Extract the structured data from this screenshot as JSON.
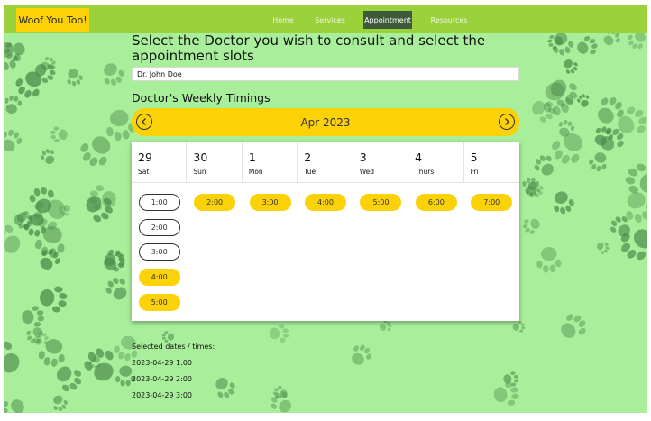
{
  "brand": "Woof You Too!",
  "nav": [
    {
      "label": "Home",
      "active": false
    },
    {
      "label": "Services",
      "active": false
    },
    {
      "label": "Appointment",
      "active": true
    },
    {
      "label": "Resources",
      "active": false
    }
  ],
  "page_title": "Select the Doctor you wish to consult and select the appointment slots",
  "doctor_field": {
    "value": "Dr. John Doe"
  },
  "weekly_title": "Doctor's Weekly Timings",
  "calendar": {
    "month": "Apr 2023",
    "prev_icon": "chevron-left-icon",
    "next_icon": "chevron-right-icon",
    "days": [
      {
        "num": "29",
        "name": "Sat",
        "slots": [
          {
            "time": "1:00",
            "state": "selected"
          },
          {
            "time": "2:00",
            "state": "selected"
          },
          {
            "time": "3:00",
            "state": "selected"
          },
          {
            "time": "4:00",
            "state": "available"
          },
          {
            "time": "5:00",
            "state": "available"
          }
        ]
      },
      {
        "num": "30",
        "name": "Sun",
        "slots": [
          {
            "time": "2:00",
            "state": "available"
          }
        ]
      },
      {
        "num": "1",
        "name": "Mon",
        "slots": [
          {
            "time": "3:00",
            "state": "available"
          }
        ]
      },
      {
        "num": "2",
        "name": "Tue",
        "slots": [
          {
            "time": "4:00",
            "state": "available"
          }
        ]
      },
      {
        "num": "3",
        "name": "Wed",
        "slots": [
          {
            "time": "5:00",
            "state": "available"
          }
        ]
      },
      {
        "num": "4",
        "name": "Thurs",
        "slots": [
          {
            "time": "6:00",
            "state": "available"
          }
        ]
      },
      {
        "num": "5",
        "name": "Fri",
        "slots": [
          {
            "time": "7:00",
            "state": "available"
          }
        ]
      }
    ]
  },
  "selected_label": "Selected dates / times:",
  "selected": [
    "2023-04-29 1:00",
    "2023-04-29 2:00",
    "2023-04-29 3:00"
  ],
  "colors": {
    "background": "#a9ef9b",
    "navbar": "#9bd23c",
    "accent": "#fbd107",
    "active_nav": "#3e5a3a"
  }
}
